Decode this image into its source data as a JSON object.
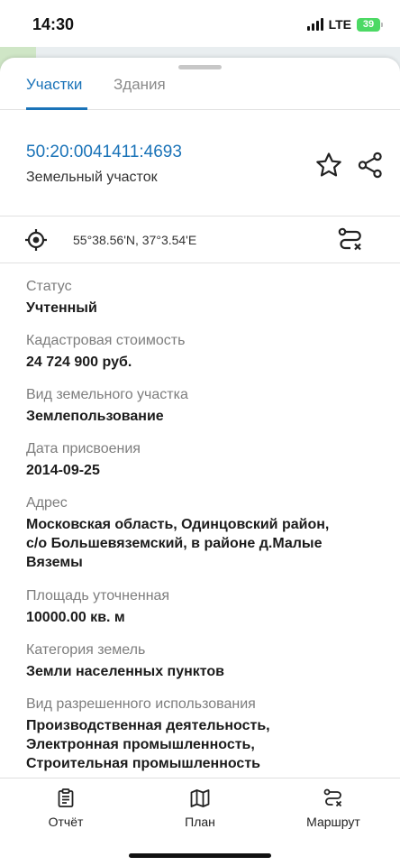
{
  "status_bar": {
    "time": "14:30",
    "network": "LTE",
    "battery": "39"
  },
  "tabs": [
    {
      "label": "Участки",
      "active": true
    },
    {
      "label": "Здания",
      "active": false
    }
  ],
  "parcel": {
    "cadastral_number": "50:20:0041411:4693",
    "type": "Земельный участок",
    "coordinates": "55°38.56'N, 37°3.54'E"
  },
  "fields": [
    {
      "label": "Статус",
      "value": "Учтенный"
    },
    {
      "label": "Кадастровая стоимость",
      "value": "24 724 900 руб."
    },
    {
      "label": "Вид земельного участка",
      "value": "Землепользование"
    },
    {
      "label": "Дата присвоения",
      "value": "2014-09-25"
    },
    {
      "label": "Адрес",
      "value_lines": [
        "Московская область, Одинцовский район,",
        "с/о Большевяземский, в районе д.Малые",
        "Вяземы"
      ]
    },
    {
      "label": "Площадь уточненная",
      "value": "10000.00 кв. м"
    },
    {
      "label": "Категория земель",
      "value": "Земли населенных пунктов"
    },
    {
      "label": "Вид разрешенного использования",
      "value_lines": [
        "Производственная деятельность,",
        "Электронная промышленность,",
        "Строительная промышленность"
      ]
    }
  ],
  "bottom_nav": [
    {
      "label": "Отчёт",
      "icon": "report-icon"
    },
    {
      "label": "План",
      "icon": "map-icon"
    },
    {
      "label": "Маршрут",
      "icon": "route-icon"
    }
  ],
  "colors": {
    "accent": "#1a73b8",
    "battery": "#4cd964"
  }
}
